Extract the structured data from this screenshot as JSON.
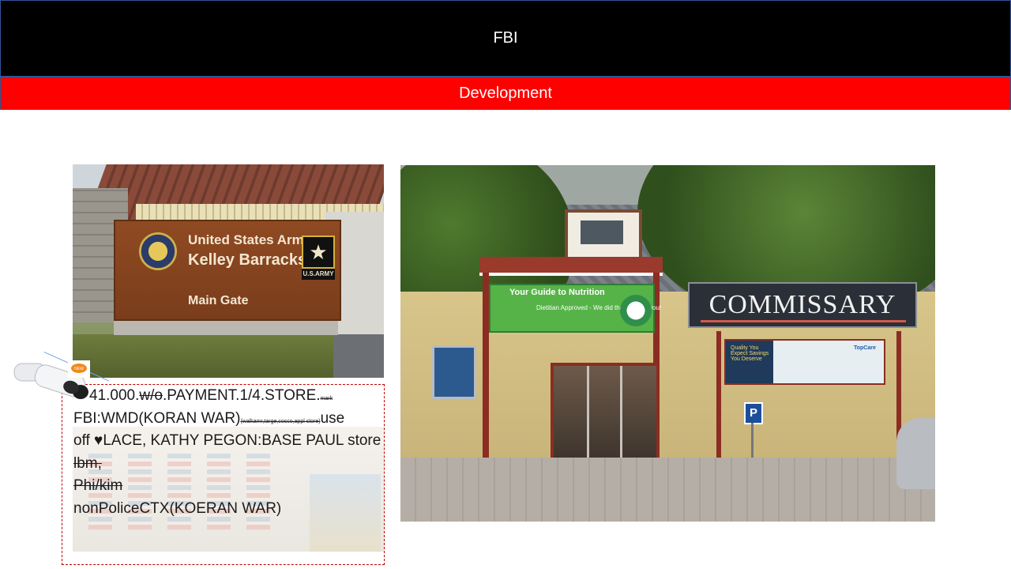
{
  "slide": {
    "title": "FBI",
    "subtitle": "Development"
  },
  "colors": {
    "title_bar": "#000000",
    "subtitle_bar": "#ff0000",
    "caption_border": "#c00000",
    "text": "#1a1a1a"
  },
  "photo_gate": {
    "sign_line1": "United States Army",
    "sign_line2": "Kelley Barracks",
    "sign_line3": "Main Gate",
    "army_tag": "U.S.ARMY"
  },
  "photo_commissary": {
    "store_sign": "COMMISSARY",
    "banner_title": "Your Guide to Nutrition",
    "banner_sub": "Dietitian Approved - We did the work for you!",
    "promo_text": "Quality You Expect Savings You Deserve",
    "promo_brand": "TopCare",
    "parking_sign": "P"
  },
  "caption": {
    "line1_a": "41.000.",
    "line1_b": "w/o",
    "line1_c": ".PAYMENT.1/4.STORE.",
    "line1_d": "mark",
    "line2_a": "FBI:WMD(KORAN WAR)",
    "line2_b": "(walkamr,targe,cosco,appl store)",
    "line2_c": "use",
    "line3": "off ♥LACE, KATHY PEGON:BASE PAUL store",
    "line4": "lbm,",
    "line5": "Phi/kim",
    "line6": "nonPoliceCTX(KOERAN WAR)",
    "camera_badge": "NEW"
  }
}
